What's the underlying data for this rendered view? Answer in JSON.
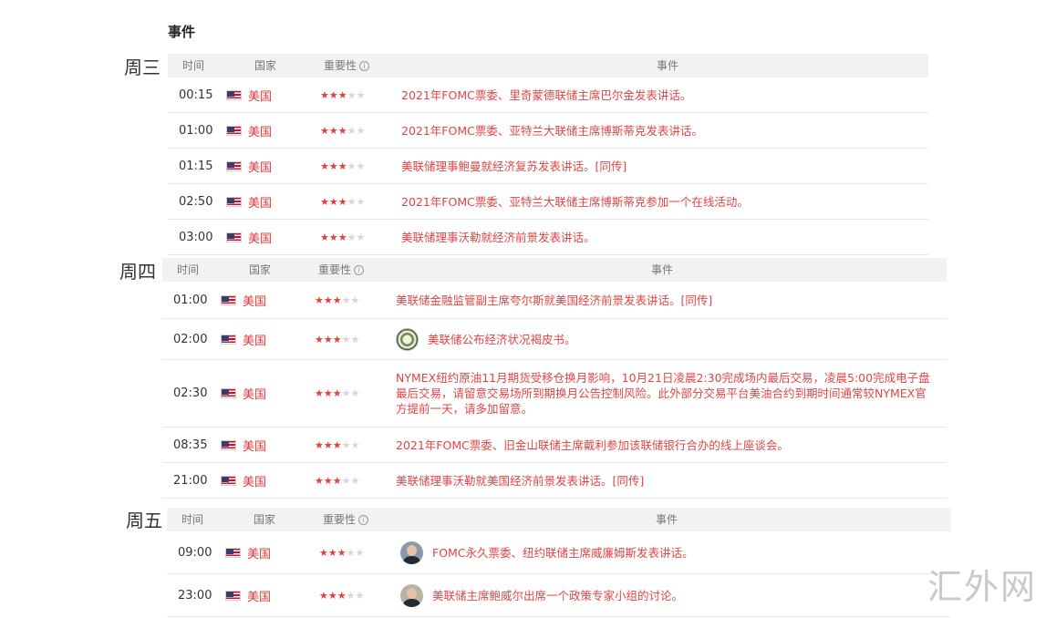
{
  "section_title": "事件",
  "watermark": "汇外网",
  "columns": {
    "time": "时间",
    "country": "国家",
    "importance": "重要性",
    "info_mark": "i",
    "event": "事件"
  },
  "days": [
    {
      "label": "周三",
      "rows": [
        {
          "time": "00:15",
          "country": "美国",
          "stars": 3,
          "event": "2021年FOMC票委、里奇蒙德联储主席巴尔金发表讲话。"
        },
        {
          "time": "01:00",
          "country": "美国",
          "stars": 3,
          "event": "2021年FOMC票委、亚特兰大联储主席博斯蒂克发表讲话。"
        },
        {
          "time": "01:15",
          "country": "美国",
          "stars": 3,
          "event": "美联储理事鲍曼就经济复苏发表讲话。[同传]"
        },
        {
          "time": "02:50",
          "country": "美国",
          "stars": 3,
          "event": "2021年FOMC票委、亚特兰大联储主席博斯蒂克参加一个在线活动。"
        },
        {
          "time": "03:00",
          "country": "美国",
          "stars": 3,
          "event": "美联储理事沃勒就经济前景发表讲话。"
        }
      ]
    },
    {
      "label": "周四",
      "rows": [
        {
          "time": "01:00",
          "country": "美国",
          "stars": 3,
          "event": "美联储金融监管副主席夸尔斯就美国经济前景发表讲话。[同传]"
        },
        {
          "time": "02:00",
          "country": "美国",
          "stars": 3,
          "event": "美联储公布经济状况褐皮书。",
          "icon": "fed-seal-icon"
        },
        {
          "time": "02:30",
          "country": "美国",
          "stars": 3,
          "event": "NYMEX纽约原油11月期货受移仓换月影响，10月21日凌晨2:30完成场内最后交易，凌晨5:00完成电子盘最后交易，请留意交易场所到期换月公告控制风险。此外部分交易平台美油合约到期时间通常较NYMEX官方提前一天，请多加留意。"
        },
        {
          "time": "08:35",
          "country": "美国",
          "stars": 3,
          "event": "2021年FOMC票委、旧金山联储主席戴利参加该联储银行合办的线上座谈会。"
        },
        {
          "time": "21:00",
          "country": "美国",
          "stars": 3,
          "event": "美联储理事沃勒就美国经济前景发表讲话。[同传]"
        }
      ]
    },
    {
      "label": "周五",
      "rows": [
        {
          "time": "09:00",
          "country": "美国",
          "stars": 3,
          "event": "FOMC永久票委、纽约联储主席威廉姆斯发表讲话。",
          "icon": "person-avatar-icon"
        },
        {
          "time": "23:00",
          "country": "美国",
          "stars": 3,
          "event": "美联储主席鲍威尔出席一个政策专家小组的讨论。",
          "icon": "person-avatar-icon"
        }
      ]
    }
  ]
}
